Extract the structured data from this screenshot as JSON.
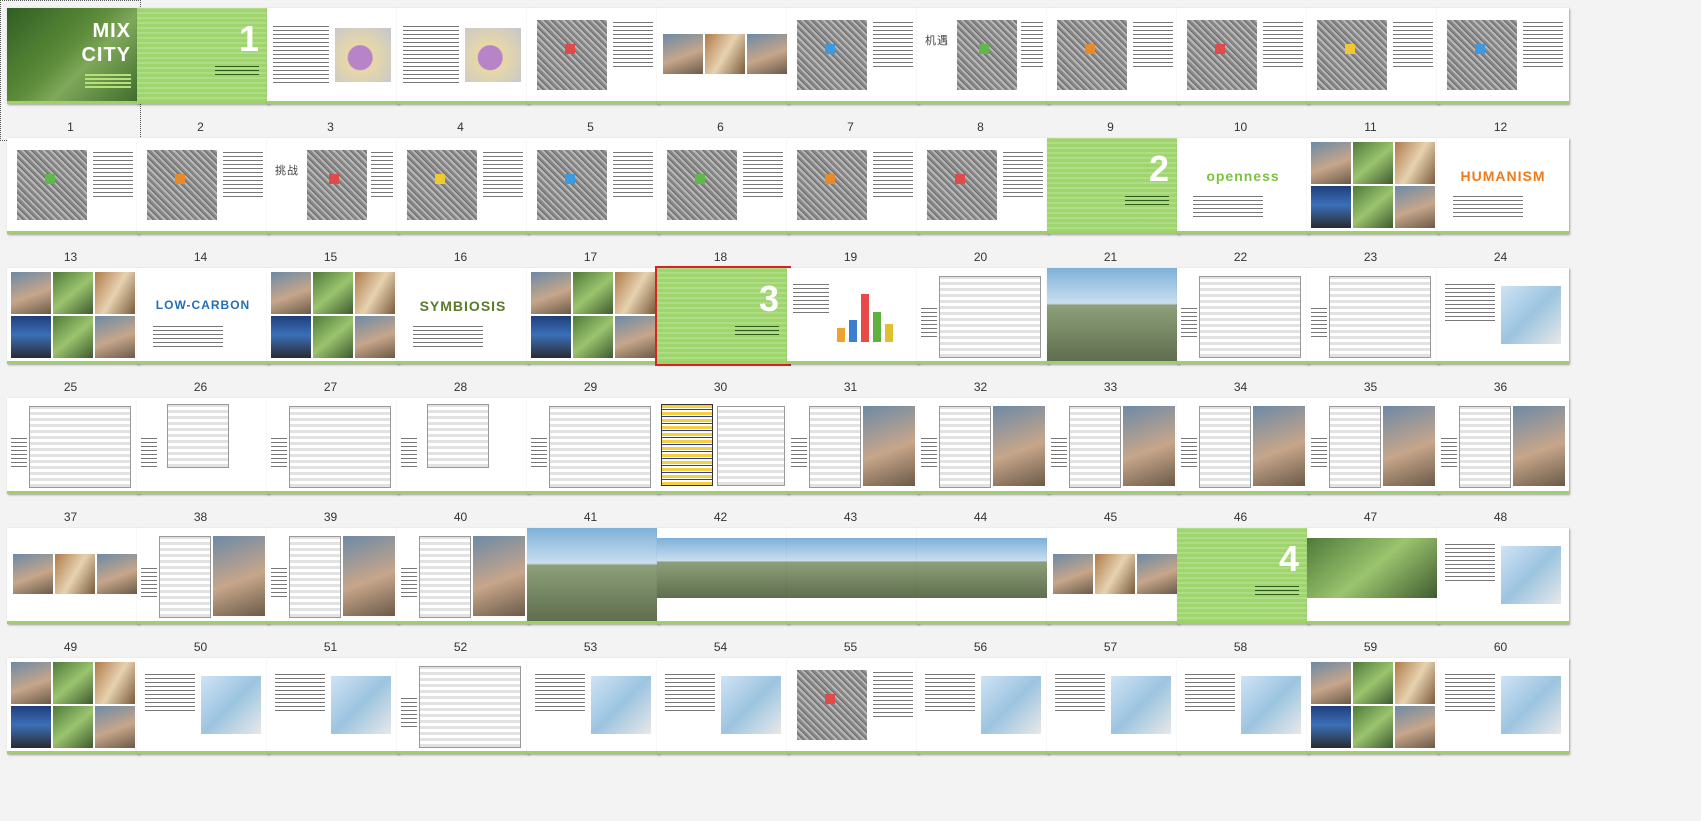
{
  "view": "slide-sorter",
  "selected_slide": 30,
  "focused_slide": 1,
  "slides": [
    {
      "n": "1",
      "kind": "cover",
      "title_lines": [
        "MIX",
        "CITY"
      ]
    },
    {
      "n": "2",
      "kind": "section",
      "sec": "1"
    },
    {
      "n": "3",
      "kind": "text-map"
    },
    {
      "n": "4",
      "kind": "text-map"
    },
    {
      "n": "5",
      "kind": "map"
    },
    {
      "n": "6",
      "kind": "photos"
    },
    {
      "n": "7",
      "kind": "map"
    },
    {
      "n": "8",
      "kind": "map-title",
      "label": "机遇"
    },
    {
      "n": "9",
      "kind": "map"
    },
    {
      "n": "10",
      "kind": "map"
    },
    {
      "n": "11",
      "kind": "map"
    },
    {
      "n": "12",
      "kind": "map"
    },
    {
      "n": "13",
      "kind": "map"
    },
    {
      "n": "14",
      "kind": "map"
    },
    {
      "n": "15",
      "kind": "map-title",
      "label": "挑战"
    },
    {
      "n": "16",
      "kind": "map"
    },
    {
      "n": "17",
      "kind": "map"
    },
    {
      "n": "18",
      "kind": "map"
    },
    {
      "n": "19",
      "kind": "map"
    },
    {
      "n": "20",
      "kind": "map"
    },
    {
      "n": "21",
      "kind": "section",
      "sec": "2"
    },
    {
      "n": "22",
      "kind": "word",
      "word": "openness",
      "color": "#7cc242"
    },
    {
      "n": "23",
      "kind": "collage"
    },
    {
      "n": "24",
      "kind": "word",
      "word": "HUMANISM",
      "color": "#f07a1a"
    },
    {
      "n": "25",
      "kind": "collage"
    },
    {
      "n": "26",
      "kind": "word",
      "word": "LOW-CARBON",
      "color": "#1f6fb8"
    },
    {
      "n": "27",
      "kind": "collage"
    },
    {
      "n": "28",
      "kind": "word",
      "word": "SYMBIOSIS",
      "color": "#5a7a2a"
    },
    {
      "n": "29",
      "kind": "collage"
    },
    {
      "n": "30",
      "kind": "section",
      "sec": "3"
    },
    {
      "n": "31",
      "kind": "chart"
    },
    {
      "n": "32",
      "kind": "plan"
    },
    {
      "n": "33",
      "kind": "render"
    },
    {
      "n": "34",
      "kind": "plan"
    },
    {
      "n": "35",
      "kind": "plan"
    },
    {
      "n": "36",
      "kind": "diagram"
    },
    {
      "n": "37",
      "kind": "plan"
    },
    {
      "n": "38",
      "kind": "plan-small"
    },
    {
      "n": "39",
      "kind": "plan"
    },
    {
      "n": "40",
      "kind": "plan-small"
    },
    {
      "n": "41",
      "kind": "plan"
    },
    {
      "n": "42",
      "kind": "table"
    },
    {
      "n": "43",
      "kind": "plan-photo"
    },
    {
      "n": "44",
      "kind": "plan-photo"
    },
    {
      "n": "45",
      "kind": "plan-photo"
    },
    {
      "n": "46",
      "kind": "plan-photo"
    },
    {
      "n": "47",
      "kind": "plan-photo"
    },
    {
      "n": "48",
      "kind": "plan-photo"
    },
    {
      "n": "49",
      "kind": "photos"
    },
    {
      "n": "50",
      "kind": "plan-photo"
    },
    {
      "n": "51",
      "kind": "plan-photo"
    },
    {
      "n": "52",
      "kind": "plan-photo"
    },
    {
      "n": "53",
      "kind": "render"
    },
    {
      "n": "54",
      "kind": "render-wide"
    },
    {
      "n": "55",
      "kind": "render-wide"
    },
    {
      "n": "56",
      "kind": "render-wide"
    },
    {
      "n": "57",
      "kind": "photos"
    },
    {
      "n": "58",
      "kind": "section",
      "sec": "4"
    },
    {
      "n": "59",
      "kind": "landscape"
    },
    {
      "n": "60",
      "kind": "diagram"
    },
    {
      "n": "",
      "kind": "collage"
    },
    {
      "n": "",
      "kind": "diagram"
    },
    {
      "n": "",
      "kind": "diagram"
    },
    {
      "n": "",
      "kind": "plan"
    },
    {
      "n": "",
      "kind": "diagram"
    },
    {
      "n": "",
      "kind": "diagram"
    },
    {
      "n": "",
      "kind": "map"
    },
    {
      "n": "",
      "kind": "diagram"
    },
    {
      "n": "",
      "kind": "diagram"
    },
    {
      "n": "",
      "kind": "diagram"
    },
    {
      "n": "",
      "kind": "collage-small"
    },
    {
      "n": "",
      "kind": "diagram"
    }
  ],
  "row_numbers": [
    [
      "1",
      "2",
      "3",
      "4",
      "5",
      "6",
      "7",
      "8",
      "9",
      "10",
      "11",
      "12"
    ],
    [
      "13",
      "14",
      "15",
      "16",
      "17",
      "18",
      "19",
      "20",
      "21",
      "22",
      "23",
      "24"
    ],
    [
      "25",
      "26",
      "27",
      "28",
      "29",
      "30",
      "31",
      "32",
      "33",
      "34",
      "35",
      "36"
    ],
    [
      "37",
      "38",
      "39",
      "40",
      "41",
      "42",
      "43",
      "44",
      "45",
      "46",
      "47",
      "48"
    ],
    [
      "49",
      "50",
      "51",
      "52",
      "53",
      "54",
      "55",
      "56",
      "57",
      "58",
      "59",
      "60"
    ]
  ],
  "colors": {
    "accent_green": "#9fd56d",
    "selection_red": "#d62424"
  }
}
